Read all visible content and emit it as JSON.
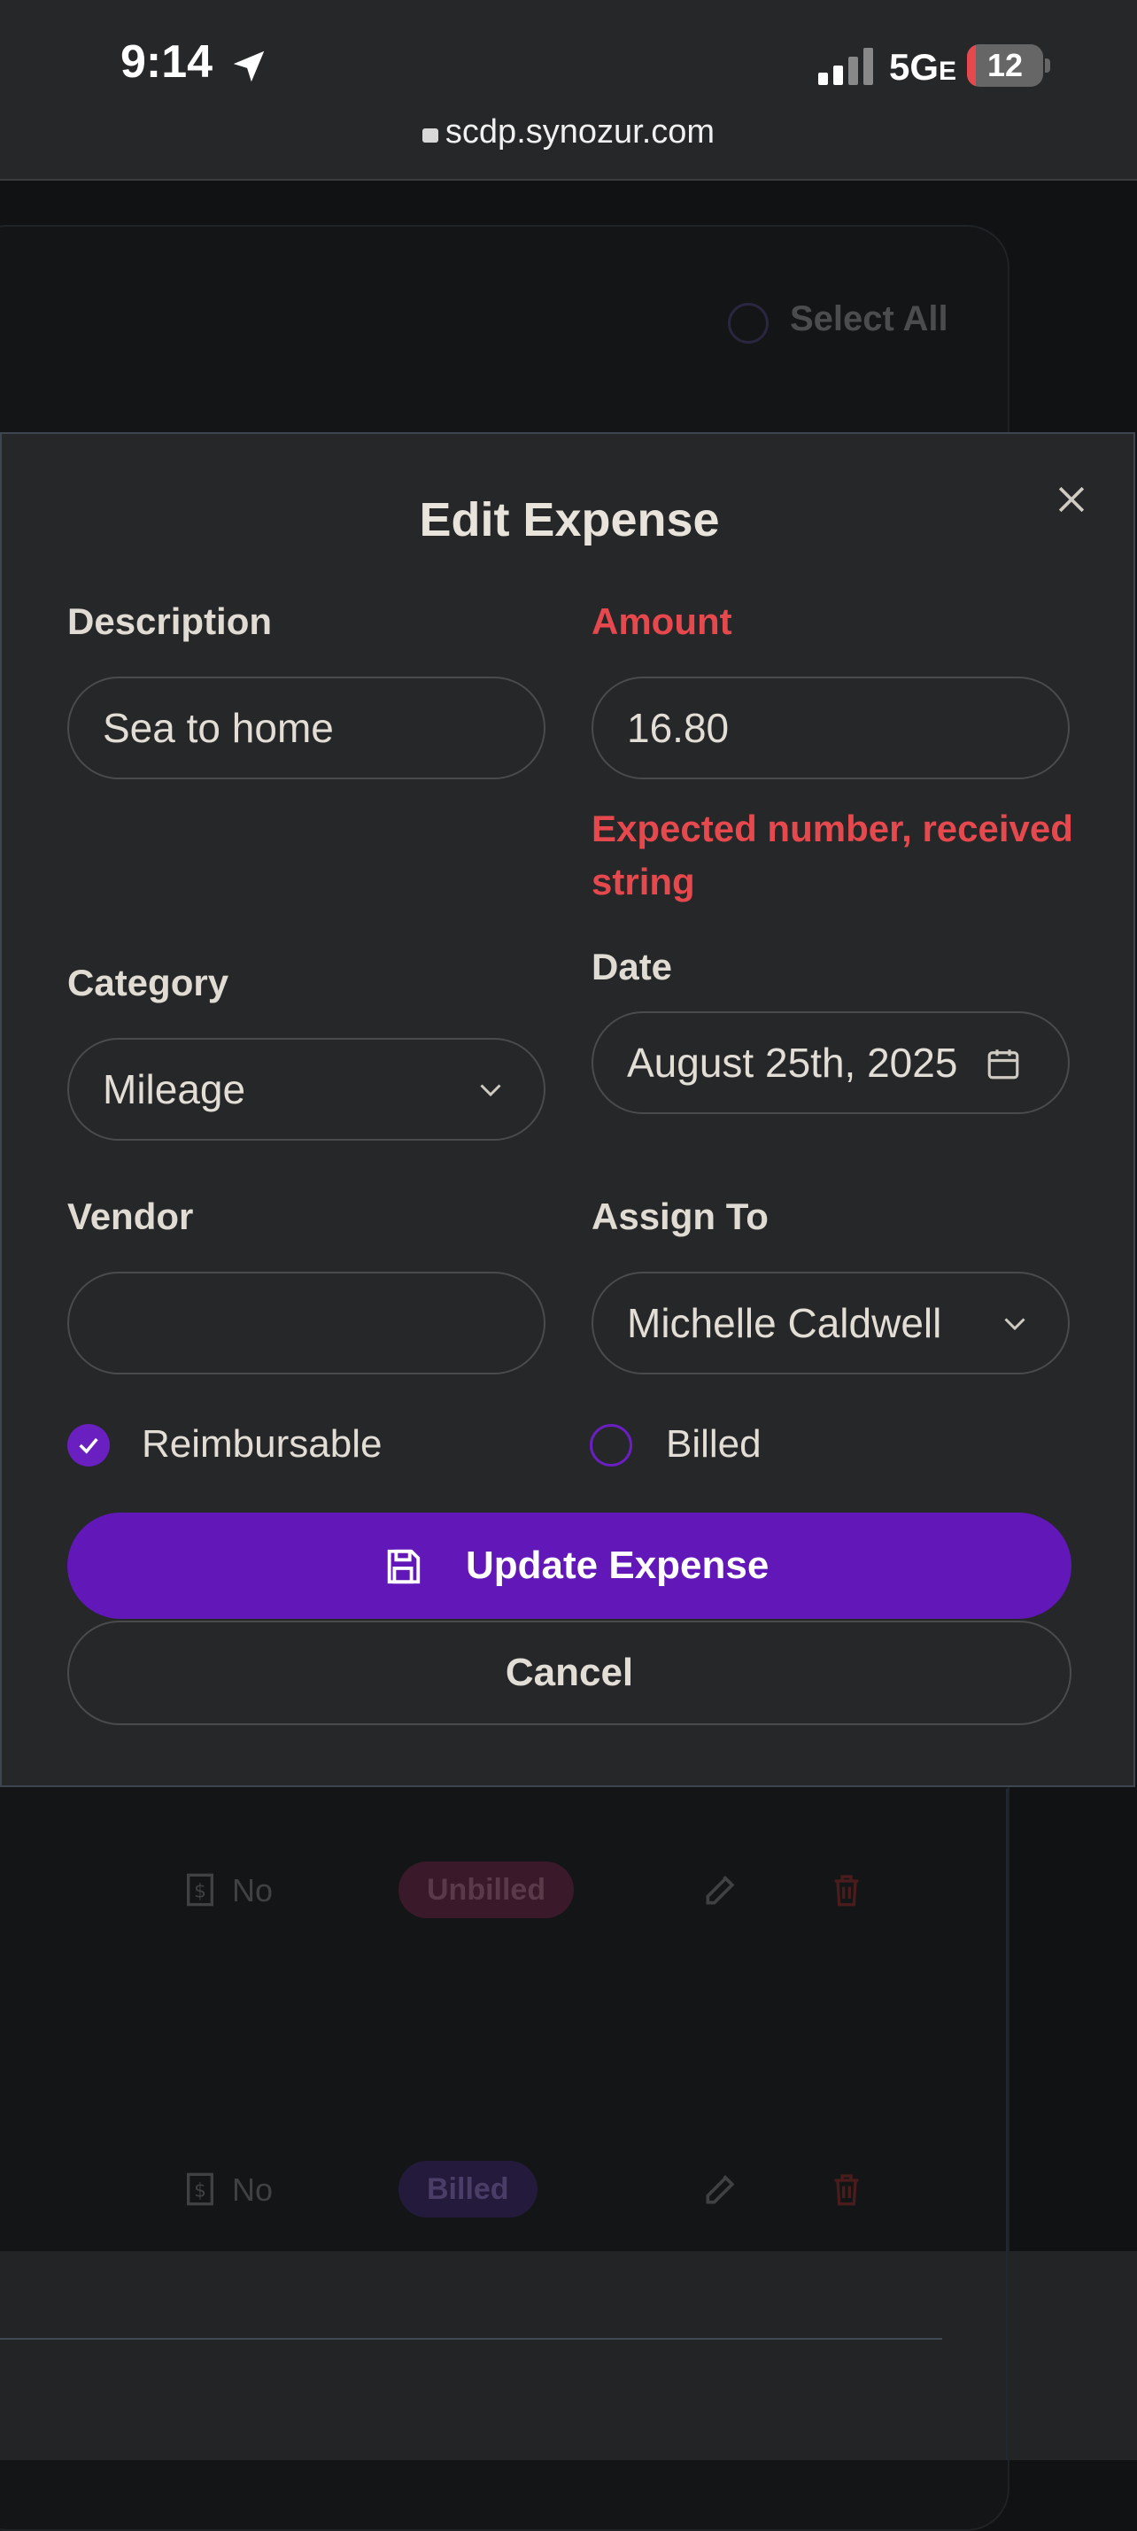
{
  "status_bar": {
    "time": "9:14",
    "network": "5G",
    "network_suffix": "E",
    "battery": "12",
    "battery_level": 0.12
  },
  "browser": {
    "url": "scdp.synozur.com"
  },
  "background": {
    "select_all_label": "Select All",
    "rows": [
      {
        "reimbursable": "No",
        "status": "Unbilled",
        "status_color": "#3a1a2a",
        "status_text_color": "#5a3a48"
      },
      {
        "reimbursable": "No",
        "status": "Billed",
        "status_color": "#241a3c",
        "status_text_color": "#4a3e66"
      }
    ]
  },
  "modal": {
    "title": "Edit Expense",
    "description": {
      "label": "Description",
      "value": "Sea to home"
    },
    "amount": {
      "label": "Amount",
      "value": "16.80",
      "error": "Expected number, received string"
    },
    "category": {
      "label": "Category",
      "value": "Mileage"
    },
    "date": {
      "label": "Date",
      "value": "August 25th, 2025"
    },
    "vendor": {
      "label": "Vendor",
      "value": ""
    },
    "assign_to": {
      "label": "Assign To",
      "value": "Michelle Caldwell"
    },
    "reimbursable": {
      "label": "Reimbursable",
      "checked": true
    },
    "billed": {
      "label": "Billed",
      "checked": false
    },
    "update_button": "Update Expense",
    "cancel_button": "Cancel"
  },
  "colors": {
    "accent": "#6217b8",
    "error": "#e5484d",
    "modal_bg": "#262728"
  }
}
